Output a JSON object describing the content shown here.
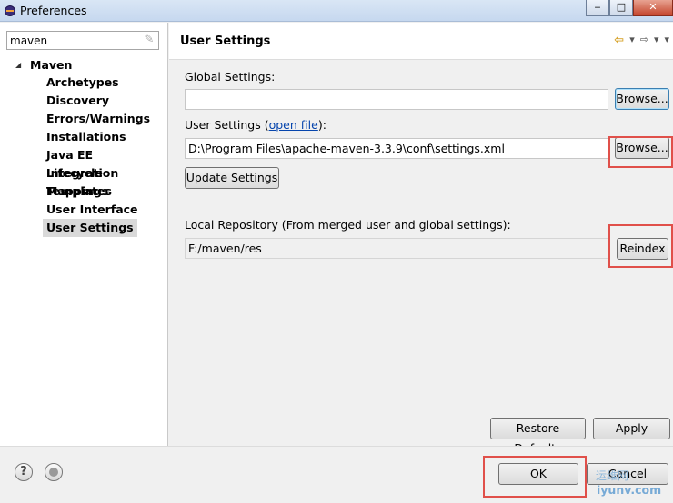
{
  "window": {
    "title": "Preferences",
    "minimize_glyph": "‒",
    "maximize_glyph": "□",
    "close_glyph": "✕"
  },
  "filter": {
    "value": "maven",
    "clear_icon_glyph": "✎"
  },
  "tree": {
    "root_arrow_glyph": "◢",
    "root_label": "Maven",
    "items": [
      "Archetypes",
      "Discovery",
      "Errors/Warnings",
      "Installations",
      "Java EE Integration",
      "Lifecycle Mappings",
      "Templates",
      "User Interface",
      "User Settings"
    ],
    "selected_item": "User Settings"
  },
  "page": {
    "title": "User Settings",
    "nav": {
      "back_glyph": "⇦",
      "back_menu_glyph": "▾",
      "forward_glyph": "⇨",
      "forward_menu_glyph": "▾",
      "view_menu_glyph": "▾"
    },
    "global_settings": {
      "label": "Global Settings:",
      "value": "",
      "browse_label": "Browse..."
    },
    "user_settings": {
      "label": "User Settings (",
      "link_text": "open file",
      "label_end": "):",
      "value": "D:\\Program Files\\apache-maven-3.3.9\\conf\\settings.xml",
      "browse_label": "Browse..."
    },
    "update_settings_label": "Update Settings",
    "local_repository": {
      "label": "Local Repository (From merged user and global settings):",
      "value": "F:/maven/res",
      "reindex_label": "Reindex"
    },
    "restore_defaults_label": "Restore Defaults",
    "apply_label": "Apply"
  },
  "bottom": {
    "help_glyph": "?",
    "ok_label": "OK",
    "cancel_label": "Cancel"
  },
  "watermark": {
    "line1": "运维网",
    "line2": "iyunv.com"
  },
  "colors": {
    "highlight": "#e0504a",
    "link": "#0645ad",
    "selected_bg": "#d9d9d9"
  }
}
